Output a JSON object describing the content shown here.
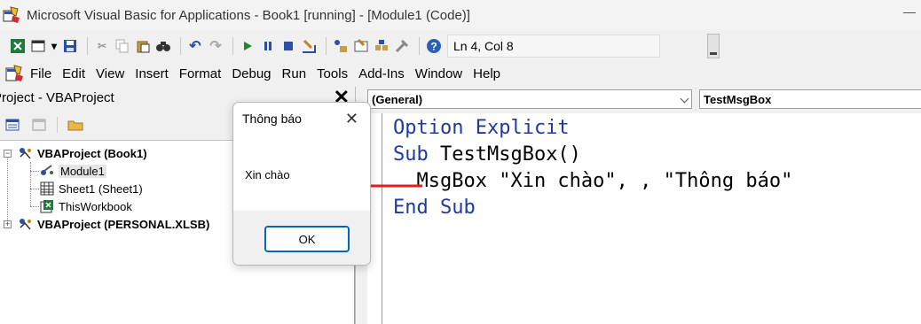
{
  "window": {
    "title": "Microsoft Visual Basic for Applications - Book1 [running] - [Module1 (Code)]"
  },
  "toolbar": {
    "status": "Ln 4, Col 8"
  },
  "menu": [
    "File",
    "Edit",
    "View",
    "Insert",
    "Format",
    "Debug",
    "Run",
    "Tools",
    "Add-Ins",
    "Window",
    "Help"
  ],
  "project": {
    "title": "Project - VBAProject",
    "close_label": "✕",
    "tree": {
      "book1": "VBAProject (Book1)",
      "module1": "Module1",
      "sheet1": "Sheet1 (Sheet1)",
      "thisworkbook": "ThisWorkbook",
      "personal": "VBAProject (PERSONAL.XLSB)"
    }
  },
  "code": {
    "object_combo": "(General)",
    "proc_combo": "TestMsgBox",
    "lines": [
      {
        "kw": "Option Explicit",
        "plain": ""
      },
      {
        "kw": "Sub ",
        "plain": "TestMsgBox()"
      },
      {
        "kw": "",
        "plain": "  MsgBox \"Xin chào\", , \"Thông báo\""
      },
      {
        "kw": "End Sub",
        "plain": ""
      }
    ]
  },
  "dialog": {
    "title": "Thông báo",
    "close_label": "✕",
    "message": "Xin chào",
    "ok_label": "OK"
  },
  "colors": {
    "keyword": "#1e3aa0",
    "annotation_arrow": "#e02020",
    "ok_border": "#0067c0"
  }
}
